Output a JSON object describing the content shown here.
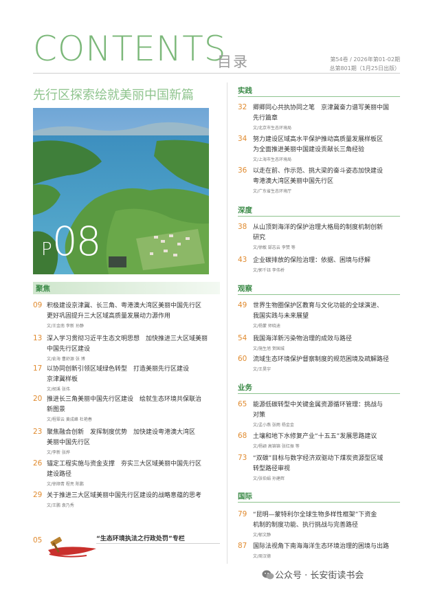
{
  "header": {
    "contents": "CONTENTS",
    "mulu": "目录",
    "issue_line1": "第54卷 / 2026年第01-02期",
    "issue_line2": "总第801期（1月25日出版）"
  },
  "feature": {
    "title": "先行区探索绘就美丽中国新篇",
    "page_p": "P",
    "page_n": "08"
  },
  "left_section": {
    "label": "聚焦",
    "items": [
      {
        "num": "09",
        "title1": "积极建设京津冀、长三角、粤港澳大湾区美丽中国先行区",
        "title2": "更好巩固提升三大区域高质量发展动力源作用",
        "title3": "",
        "author": "文/王金南  李新  孙静"
      },
      {
        "num": "13",
        "title1": "深入学习贯彻习近平生态文明思想　加快推进三大区域美丽",
        "title2": "中国先行区建设",
        "title3": "",
        "author": "文/俞海  曹舒源  张  博"
      },
      {
        "num": "17",
        "title1": "以协同创新引领区域绿色转型　打造美丽先行区建设",
        "title2": "京津冀样板",
        "title3": "",
        "author": "文/胡溪  张伟"
      },
      {
        "num": "20",
        "title1": "推进长三角美丽中国先行区建设　绘就生态环境共保联治",
        "title2": "新图景",
        "title3": "",
        "author": "文/程翠云  黄成峰  杜艳春"
      },
      {
        "num": "23",
        "title1": "聚焦融合创新　发挥制度优势　加快建设粤港澳大湾区",
        "title2": "美丽中国先行区",
        "title3": "",
        "author": "文/李新  张烨"
      },
      {
        "num": "26",
        "title1": "锚定工程实施与资金支撑　夯实三大区域美丽中国先行区",
        "title2": "建设路径",
        "title3": "",
        "author": "文/徐顺青  程亮  陈鹏"
      },
      {
        "num": "29",
        "title1": "关于推进三大区域美丽中国先行区建设的战略意蕴的思考",
        "title2": "",
        "title3": "",
        "author": "文/王鹏  袁乃秀"
      }
    ]
  },
  "special_column": {
    "num": "05",
    "title": "“生态环境执法之行政处罚”专栏"
  },
  "right_sections": [
    {
      "label": "实践",
      "items": [
        {
          "num": "32",
          "title1": "卿卿同心共执协同之笔　京津冀奋力谱写美丽中国",
          "title2": "先行篇章",
          "author": "文/北京市生态环境局"
        },
        {
          "num": "34",
          "title1": "努力建设区域高水平保护推动高质量发展样板区",
          "title2": "为全面推进美丽中国建设贡献长三角经验",
          "author": "文/上海市生态环境局"
        },
        {
          "num": "36",
          "title1": "以走在前、作示范、挑大梁的奋斗姿态加快建设",
          "title2": "粤港澳大湾区美丽中国先行区",
          "author": "文/广东省生态环境厅"
        }
      ]
    },
    {
      "label": "深度",
      "items": [
        {
          "num": "38",
          "title1": "从山顶到海洋的保护治理大格局的制度机制创新",
          "title2": "研究",
          "author": "文/徐敏  郜志云  李赞  等"
        },
        {
          "num": "43",
          "title1": "企业碳排放的保险治理：依据、困境与纾解",
          "title2": "",
          "author": "文/郭千钰  李伟桥"
        }
      ]
    },
    {
      "label": "观察",
      "items": [
        {
          "num": "49",
          "title1": "世界生物圈保护区教育与文化功能的全球演进、",
          "title2": "我国实践与未来展望",
          "author": "文/杨蒙  师晓迪"
        },
        {
          "num": "54",
          "title1": "我国海洋新污染物治理的成效与路径",
          "title2": "",
          "author": "文/施生旭  贺国城"
        },
        {
          "num": "60",
          "title1": "流域生态环境保护督察制度的规范困境及疏解路径",
          "title2": "",
          "author": "文/王昊宇"
        }
      ]
    },
    {
      "label": "业务",
      "items": [
        {
          "num": "65",
          "title1": "能源低碳转型中关键金属资源循环管理：挑战与",
          "title2": "对策",
          "author": "文/孟小燕  张雨  杨金金"
        },
        {
          "num": "68",
          "title1": "土壤和地下水修复产业“十五五”发展思路建议",
          "title2": "",
          "author": "文/杨颖  高锦锦  张红振  等"
        },
        {
          "num": "73",
          "title1": "“双碳”目标与数字经济双驱动下煤炭资源型区域",
          "title2": "转型路径审视",
          "author": "文/张伯娟  孙建辉"
        }
      ]
    },
    {
      "label": "国际",
      "items": [
        {
          "num": "79",
          "title1": "“昆明—蒙特利尔全球生物多样性框架”下资金",
          "title2": "机制的制度功能、执行挑战与完善路径",
          "author": "文/郁文静"
        },
        {
          "num": "87",
          "title1": "国际法视角下南海海洋生态环境治理的困境与出路",
          "title2": "",
          "author": "文/周汉德"
        }
      ]
    }
  ],
  "watermark": "公众号 · 长安街读书会",
  "colors": {
    "accent_green": "#7cb87a",
    "section_green": "#3b8a47",
    "page_orange": "#e08a2e"
  }
}
